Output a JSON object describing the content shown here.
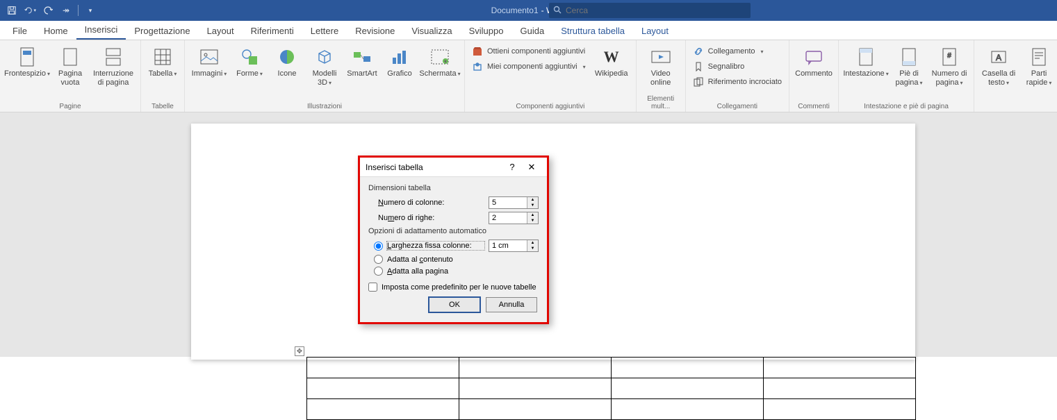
{
  "titlebar": {
    "document": "Documento1",
    "suffix": " -  Word",
    "search_placeholder": "Cerca"
  },
  "tabs": {
    "file": "File",
    "home": "Home",
    "inserisci": "Inserisci",
    "progettazione": "Progettazione",
    "layout": "Layout",
    "riferimenti": "Riferimenti",
    "lettere": "Lettere",
    "revisione": "Revisione",
    "visualizza": "Visualizza",
    "sviluppo": "Sviluppo",
    "guida": "Guida",
    "struttura": "Struttura tabella",
    "layout2": "Layout"
  },
  "ribbon": {
    "pagine": {
      "label": "Pagine",
      "frontespizio": "Frontespizio",
      "pagina_vuota": "Pagina vuota",
      "interruzione": "Interruzione di pagina"
    },
    "tabelle": {
      "label": "Tabelle",
      "tabella": "Tabella"
    },
    "illustrazioni": {
      "label": "Illustrazioni",
      "immagini": "Immagini",
      "forme": "Forme",
      "icone": "Icone",
      "modelli3d": "Modelli 3D",
      "smartart": "SmartArt",
      "grafico": "Grafico",
      "schermata": "Schermata"
    },
    "aggiuntivi": {
      "label": "Componenti aggiuntivi",
      "ottieni": "Ottieni componenti aggiuntivi",
      "miei": "Miei componenti aggiuntivi",
      "wikipedia": "Wikipedia"
    },
    "mult": {
      "label": "Elementi mult...",
      "video": "Video online"
    },
    "collegamenti": {
      "label": "Collegamenti",
      "collegamento": "Collegamento",
      "segnalibro": "Segnalibro",
      "riferimento": "Riferimento incrociato"
    },
    "commenti": {
      "label": "Commenti",
      "commento": "Commento"
    },
    "intestazione": {
      "label": "Intestazione e piè di pagina",
      "intest": "Intestazione",
      "pie": "Piè di pagina",
      "numero": "Numero di pagina"
    },
    "testo": {
      "casella": "Casella di testo",
      "parti": "Parti rapide"
    }
  },
  "dialog": {
    "title": "Inserisci tabella",
    "section1": "Dimensioni tabella",
    "num_colonne_label": "Numero di colonne:",
    "num_colonne_value": "5",
    "num_righe_label": "Numero di righe:",
    "num_righe_value": "2",
    "section2": "Opzioni di adattamento automatico",
    "larghezza_label": "Larghezza fissa colonne:",
    "larghezza_value": "1 cm",
    "adatta_contenuto": "Adatta al contenuto",
    "adatta_pagina": "Adatta alla pagina",
    "predefinito": "Imposta come predefinito per le nuove tabelle",
    "ok": "OK",
    "annulla": "Annulla"
  }
}
